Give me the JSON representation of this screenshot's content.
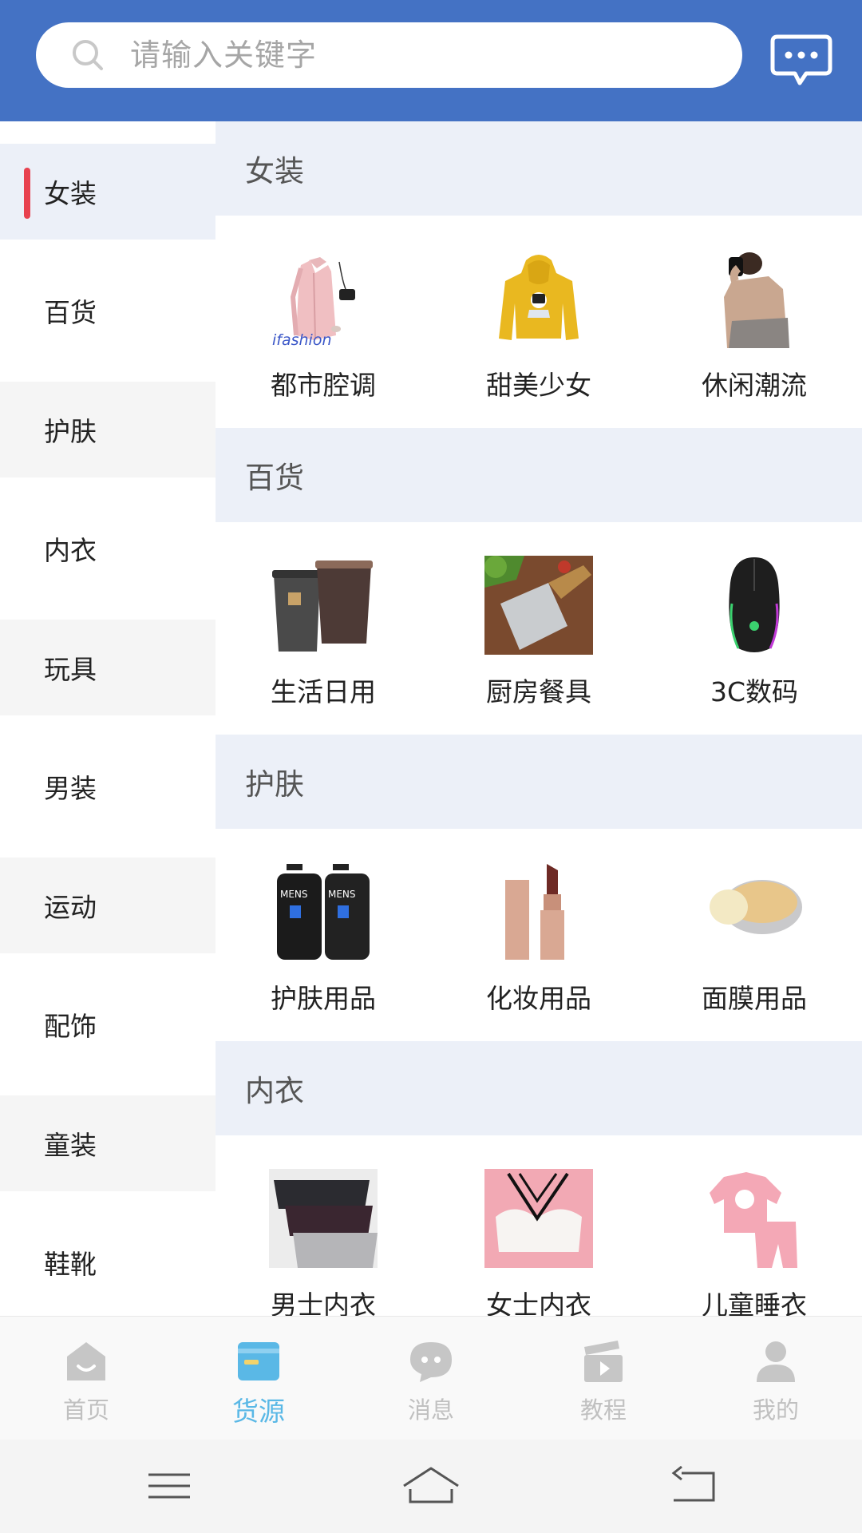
{
  "search": {
    "placeholder": "请输入关键字"
  },
  "sidebar": {
    "items": [
      {
        "label": "女装"
      },
      {
        "label": "百货"
      },
      {
        "label": "护肤"
      },
      {
        "label": "内衣"
      },
      {
        "label": "玩具"
      },
      {
        "label": "男装"
      },
      {
        "label": "运动"
      },
      {
        "label": "配饰"
      },
      {
        "label": "童装"
      },
      {
        "label": "鞋靴"
      }
    ],
    "active_index": 0
  },
  "sections": [
    {
      "title": "女装",
      "items": [
        {
          "label": "都市腔调",
          "image_text": "ifashion"
        },
        {
          "label": "甜美少女"
        },
        {
          "label": "休闲潮流"
        }
      ]
    },
    {
      "title": "百货",
      "items": [
        {
          "label": "生活日用"
        },
        {
          "label": "厨房餐具"
        },
        {
          "label": "3C数码"
        }
      ]
    },
    {
      "title": "护肤",
      "items": [
        {
          "label": "护肤用品",
          "image_text": "MENS"
        },
        {
          "label": "化妆用品"
        },
        {
          "label": "面膜用品"
        }
      ]
    },
    {
      "title": "内衣",
      "items": [
        {
          "label": "男士内衣"
        },
        {
          "label": "女士内衣"
        },
        {
          "label": "儿童睡衣"
        }
      ]
    }
  ],
  "tabbar": {
    "tabs": [
      {
        "label": "首页",
        "icon": "home-icon"
      },
      {
        "label": "货源",
        "icon": "card-icon"
      },
      {
        "label": "消息",
        "icon": "chat-icon"
      },
      {
        "label": "教程",
        "icon": "video-icon"
      },
      {
        "label": "我的",
        "icon": "user-icon"
      }
    ],
    "active_index": 1
  },
  "colors": {
    "header": "#4472c4",
    "accent_red": "#e8424f",
    "tab_active": "#5ab8e6",
    "section_bg": "#ecf0f8"
  }
}
